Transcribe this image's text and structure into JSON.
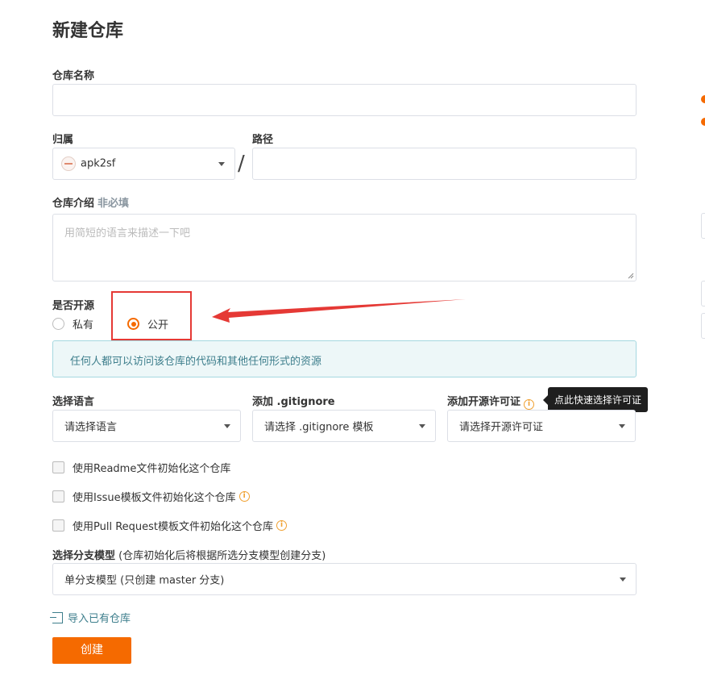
{
  "page": {
    "title": "新建仓库"
  },
  "fields": {
    "repo_name": {
      "label": "仓库名称",
      "value": "",
      "placeholder": ""
    },
    "owner": {
      "label": "归属",
      "value": "apk2sf"
    },
    "path": {
      "label": "路径",
      "value": ""
    },
    "separator": "/",
    "description": {
      "label": "仓库介绍",
      "optional_tag": "非必填",
      "placeholder": "用简短的语言来描述一下吧"
    }
  },
  "visibility": {
    "label": "是否开源",
    "options": [
      {
        "label": "私有",
        "selected": false
      },
      {
        "label": "公开",
        "selected": true
      }
    ],
    "info_text": "任何人都可以访问该仓库的代码和其他任何形式的资源"
  },
  "language": {
    "label": "选择语言",
    "value": "请选择语言"
  },
  "gitignore": {
    "label": "添加 .gitignore",
    "value": "请选择 .gitignore 模板"
  },
  "license": {
    "label": "添加开源许可证",
    "value": "请选择开源许可证",
    "tooltip": "点此快速选择许可证"
  },
  "init_options": [
    {
      "label": "使用Readme文件初始化这个仓库",
      "checked": false,
      "has_info": false
    },
    {
      "label": "使用Issue模板文件初始化这个仓库",
      "checked": false,
      "has_info": true
    },
    {
      "label": "使用Pull Request模板文件初始化这个仓库",
      "checked": false,
      "has_info": true
    }
  ],
  "branch_model": {
    "label": "选择分支模型",
    "hint": "(仓库初始化后将根据所选分支模型创建分支)",
    "value": "单分支模型 (只创建 master 分支)"
  },
  "import_link": "导入已有仓库",
  "create_button": "创建",
  "annotation": {
    "arrow_color": "#e53935"
  },
  "colors": {
    "accent": "#f56a00",
    "info_bg": "#edf7f8",
    "info_text": "#3d7e8c"
  }
}
